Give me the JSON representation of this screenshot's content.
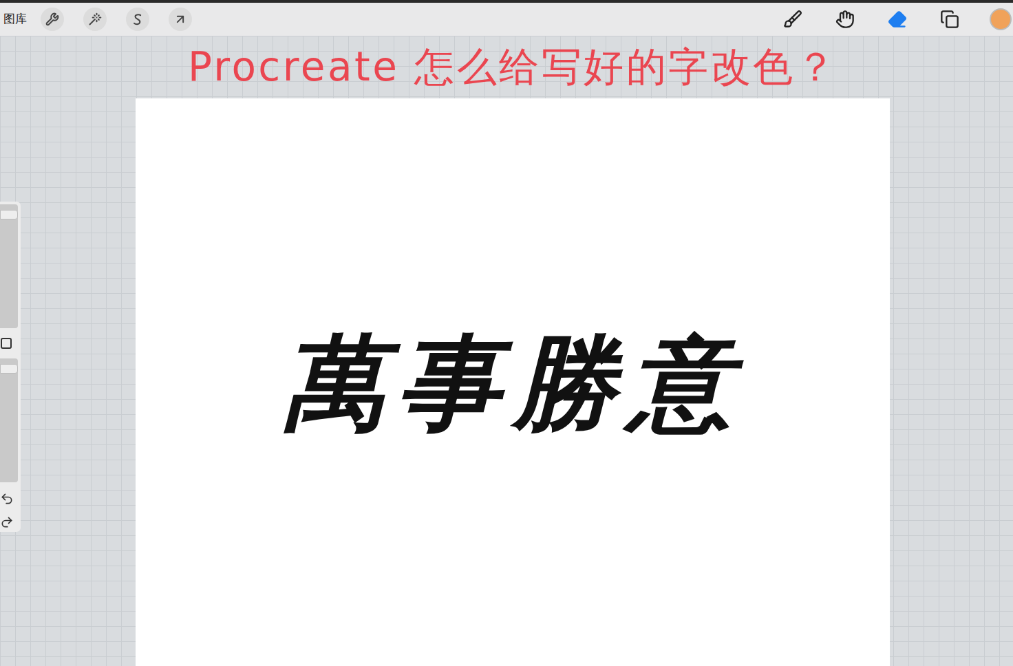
{
  "toolbar": {
    "gallery": "图库",
    "right_tools": [
      {
        "kind": "brush",
        "selected": false
      },
      {
        "kind": "smudge",
        "selected": false
      },
      {
        "kind": "eraser",
        "selected": true
      },
      {
        "kind": "layers",
        "selected": false
      }
    ],
    "current_color": "#f0a25a"
  },
  "title_annotation": "Procreate 怎么给写好的字改色？",
  "canvas": {
    "artwork_text": "萬事勝意"
  },
  "sidebar": {
    "size_slider": {
      "level": 0.95
    },
    "opacity_slider": {
      "level": 0.95
    }
  }
}
